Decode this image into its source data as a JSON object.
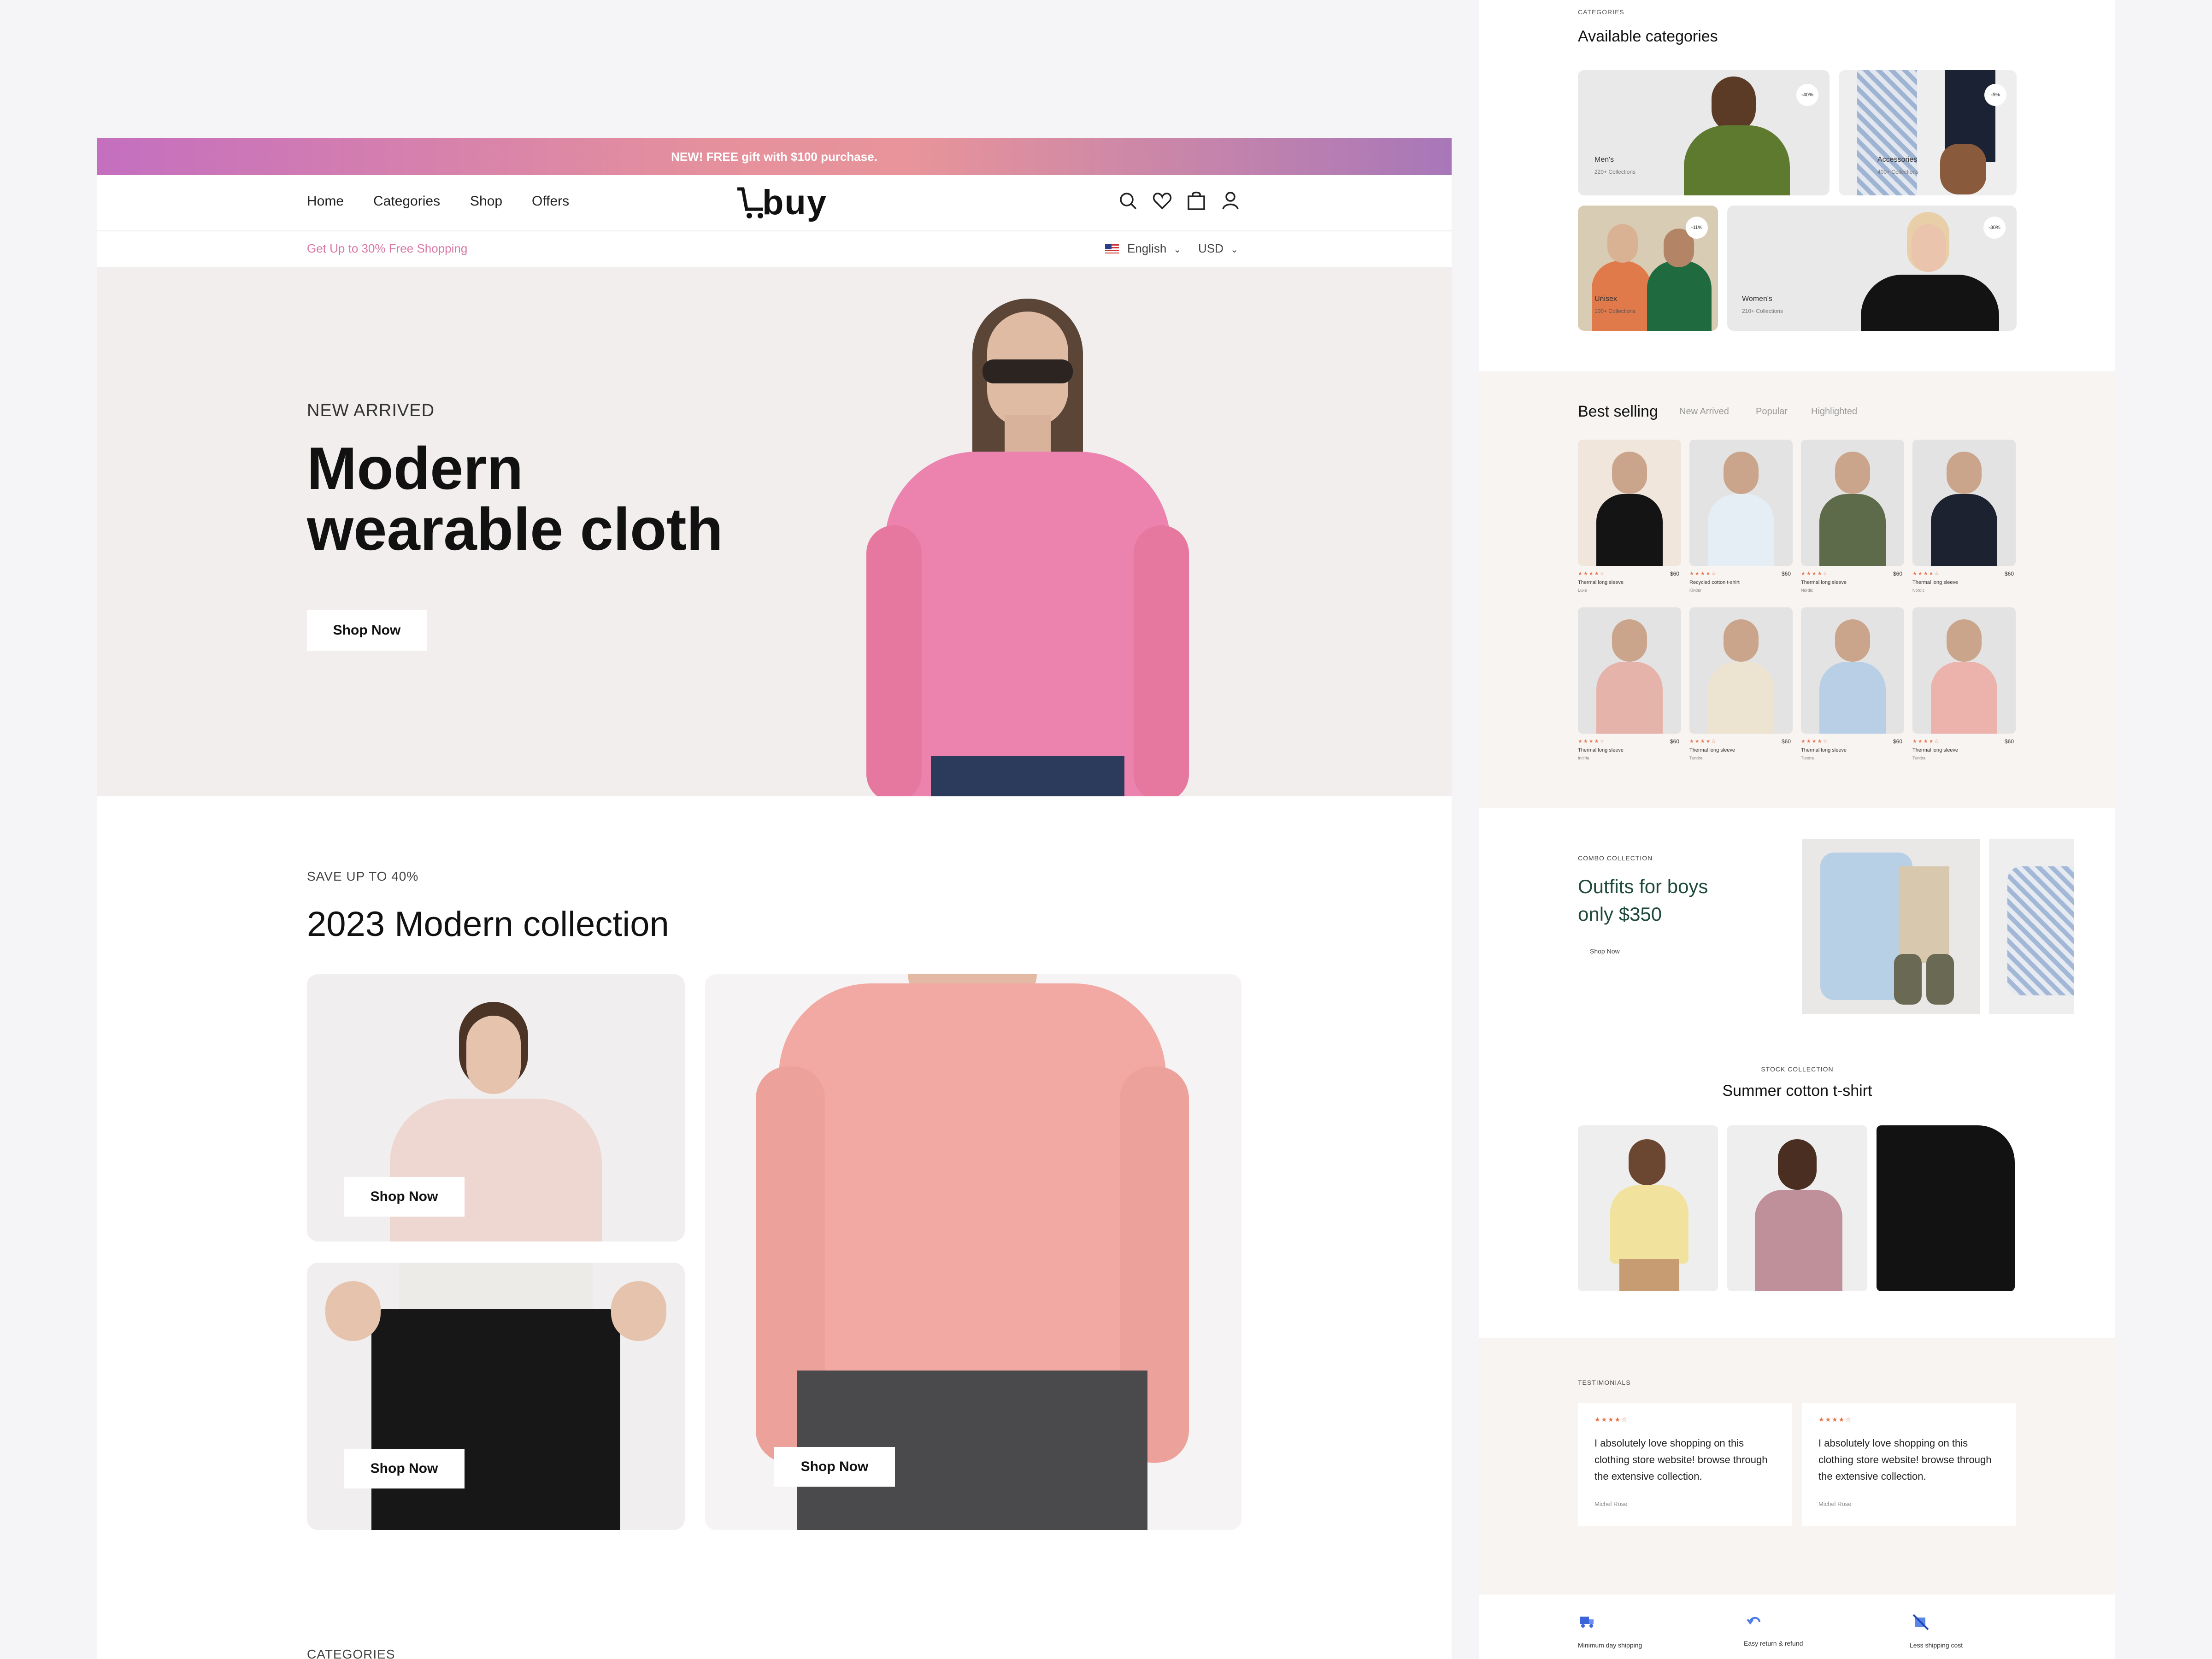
{
  "promo": {
    "text": "NEW! FREE gift with $100 purchase."
  },
  "nav": {
    "links": [
      "Home",
      "Categories",
      "Shop",
      "Offers"
    ],
    "logo": "buy"
  },
  "subbar": {
    "offer": "Get Up to 30% Free Shopping",
    "language": "English",
    "currency": "USD"
  },
  "hero": {
    "eyebrow": "NEW ARRIVED",
    "title_line1": "Modern",
    "title_line2": "wearable cloth",
    "cta": "Shop Now"
  },
  "collection": {
    "eyebrow": "SAVE UP TO 40%",
    "title": "2023 Modern collection",
    "cta": "Shop Now"
  },
  "bottom_label": "CATEGORIES",
  "categories": {
    "eyebrow": "CATEGORIES",
    "title": "Available categories",
    "items": [
      {
        "name": "Men's",
        "sub": "220+ Collections",
        "badge": "-40%"
      },
      {
        "name": "Accessories",
        "sub": "400+ Collections",
        "badge": "-5%"
      },
      {
        "name": "Unisex",
        "sub": "100+ Collections",
        "badge": "-11%"
      },
      {
        "name": "Women's",
        "sub": "210+ Collections",
        "badge": "-30%"
      }
    ]
  },
  "best_selling": {
    "title": "Best selling",
    "tabs": [
      "New Arrived",
      "Popular",
      "Highlighted"
    ],
    "products": [
      {
        "name": "Thermal long sleeve",
        "sub": "Luxe",
        "price": "$60"
      },
      {
        "name": "Recycled cotton t-shirt",
        "sub": "Kinder",
        "price": "$60"
      },
      {
        "name": "Thermal long sleeve",
        "sub": "Nordic",
        "price": "$60"
      },
      {
        "name": "Thermal long sleeve",
        "sub": "Nordic",
        "price": "$60"
      },
      {
        "name": "Thermal long sleeve",
        "sub": "Indiria",
        "price": "$60"
      },
      {
        "name": "Thermal long sleeve",
        "sub": "Tundra",
        "price": "$60"
      },
      {
        "name": "Thermal long sleeve",
        "sub": "Tundra",
        "price": "$60"
      },
      {
        "name": "Thermal long sleeve",
        "sub": "Tundra",
        "price": "$60"
      }
    ],
    "rating_stars": "★★★★☆"
  },
  "combo": {
    "eyebrow": "COMBO COLLECTION",
    "title_line1": "Outfits for boys",
    "title_line2": "only $350",
    "cta": "Shop Now"
  },
  "stock": {
    "eyebrow": "STOCK COLLECTION",
    "title": "Summer cotton t-shirt"
  },
  "testimonials": {
    "eyebrow": "TESTIMONIALS",
    "items": [
      {
        "stars": "★★★★☆",
        "text": "I absolutely love shopping on this clothing store website! browse through the extensive collection.",
        "author": "Michel Rose"
      },
      {
        "stars": "★★★★☆",
        "text": "I absolutely love shopping on this clothing store website! browse through the extensive collection.",
        "author": "Michel Rose"
      }
    ]
  },
  "features": [
    {
      "icon": "truck-icon",
      "label": "Minimum day shipping"
    },
    {
      "icon": "return-icon",
      "label": "Easy return & refund"
    },
    {
      "icon": "no-shipping-cost-icon",
      "label": "Less shipping cost"
    }
  ],
  "colors": {
    "promo_gradient": [
      "#c96fbd",
      "#e8919a",
      "#a373b9"
    ],
    "accent_green": "#1f4a3a",
    "star": "#e8744c",
    "offer_pink": "#d977a4"
  }
}
